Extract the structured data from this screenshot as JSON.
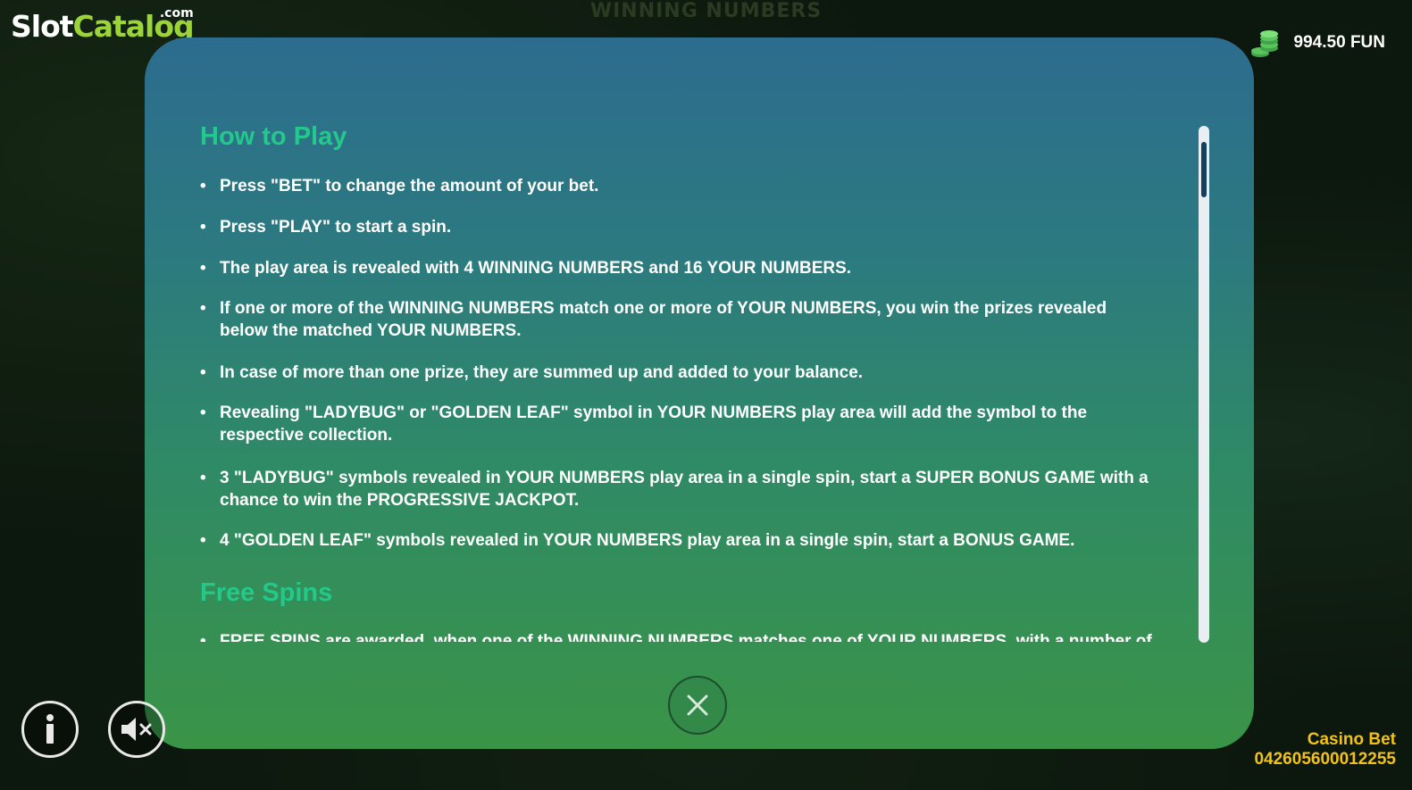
{
  "background": {
    "title": "WINNING NUMBERS"
  },
  "logo": {
    "part1": "Slot",
    "part2": "Catalog",
    "suffix": ".com"
  },
  "balance": {
    "icon": "coins-icon",
    "amount": "994.50 FUN"
  },
  "rules": {
    "how_to_play_title": "How to Play",
    "items": [
      "Press \"BET\" to change the amount of your bet.",
      "Press \"PLAY\" to start a spin.",
      "The play area is revealed with 4 WINNING NUMBERS and 16 YOUR NUMBERS.",
      "If one or more of the WINNING NUMBERS match one or more of YOUR NUMBERS, you win the prizes revealed below the matched YOUR NUMBERS.",
      "In case of more than one prize, they are summed up and added to your balance.",
      "Revealing \"LADYBUG\" or \"GOLDEN LEAF\" symbol in YOUR NUMBERS play area will add the symbol to the respective collection.",
      "3 \"LADYBUG\" symbols revealed in YOUR NUMBERS play area in a single spin, start a SUPER BONUS GAME with a chance to win the PROGRESSIVE JACKPOT.",
      "4 \"GOLDEN LEAF\" symbols revealed in YOUR NUMBERS play area in a single spin, start a BONUS GAME."
    ],
    "free_spins_title": "Free Spins",
    "free_spins_items": [
      "FREE SPINS are awarded, when one of the WINNING NUMBERS matches one of YOUR NUMBERS, with a number of"
    ]
  },
  "controls": {
    "close_icon": "close-icon",
    "info_icon": "info-icon",
    "sound_icon": "sound-muted-icon"
  },
  "footer": {
    "casino_label": "Casino Bet",
    "bet_id": "042605600012255"
  },
  "colors": {
    "heading": "#22c98a",
    "casino_text": "#f2c21b",
    "logo_accent": "#9bd33b"
  }
}
